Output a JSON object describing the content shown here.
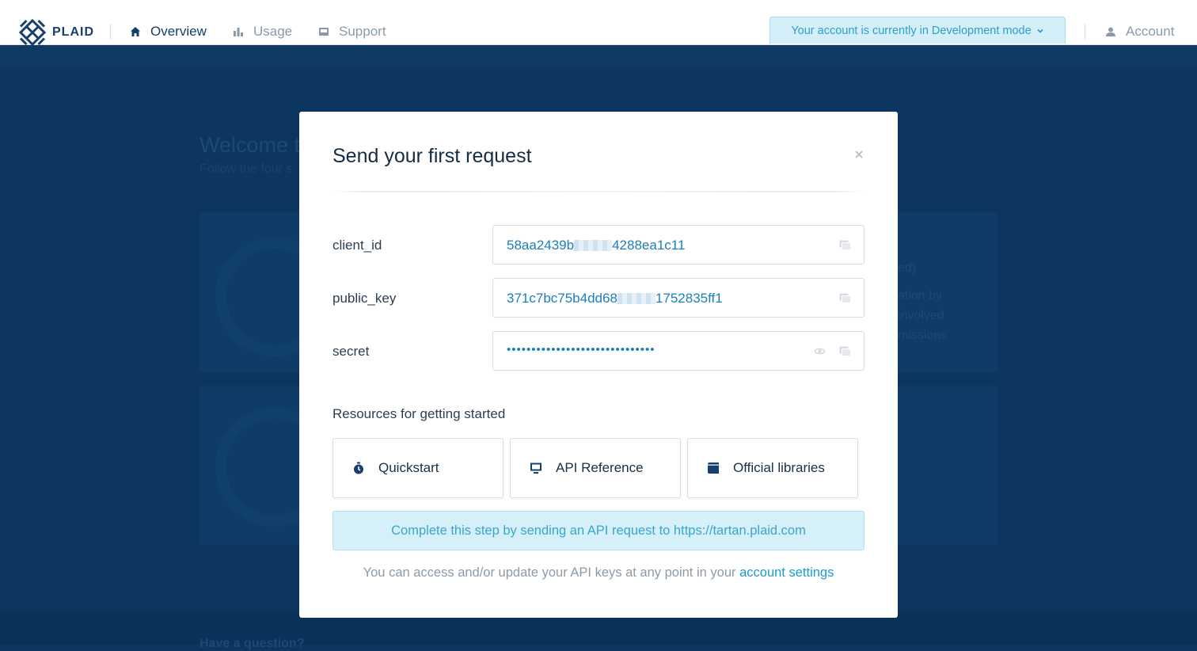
{
  "nav": {
    "brand": "PLAID",
    "items": [
      {
        "label": "Overview",
        "icon": "home-icon",
        "active": true
      },
      {
        "label": "Usage",
        "icon": "bar-chart-icon",
        "active": false
      },
      {
        "label": "Support",
        "icon": "inbox-icon",
        "active": false
      }
    ],
    "dev_mode_banner": "Your account is currently in Development mode",
    "account_label": "Account"
  },
  "modal": {
    "title": "Send your first request",
    "fields": [
      {
        "label": "client_id",
        "value_prefix": "58aa2439b",
        "value_suffix": "4288ea1c11"
      },
      {
        "label": "public_key",
        "value_prefix": "371c7bc75b4dd68",
        "value_suffix": "1752835ff1"
      },
      {
        "label": "secret",
        "value": "••••••••••••••••••••••••••••••"
      }
    ],
    "resources_title": "Resources for getting started",
    "resources": [
      {
        "label": "Quickstart",
        "icon": "stopwatch-icon"
      },
      {
        "label": "API Reference",
        "icon": "monitor-icon"
      },
      {
        "label": "Official libraries",
        "icon": "book-icon"
      }
    ],
    "callout": "Complete this step by sending an API request to https://tartan.plaid.com",
    "note_text": "You can access and/or update your API keys at any point in your",
    "note_link": "account settings"
  },
  "colors": {
    "brand": "#16406b",
    "overlay": "#0c365f",
    "link": "#1a9bd0",
    "callout_bg": "#d6f0fa"
  }
}
